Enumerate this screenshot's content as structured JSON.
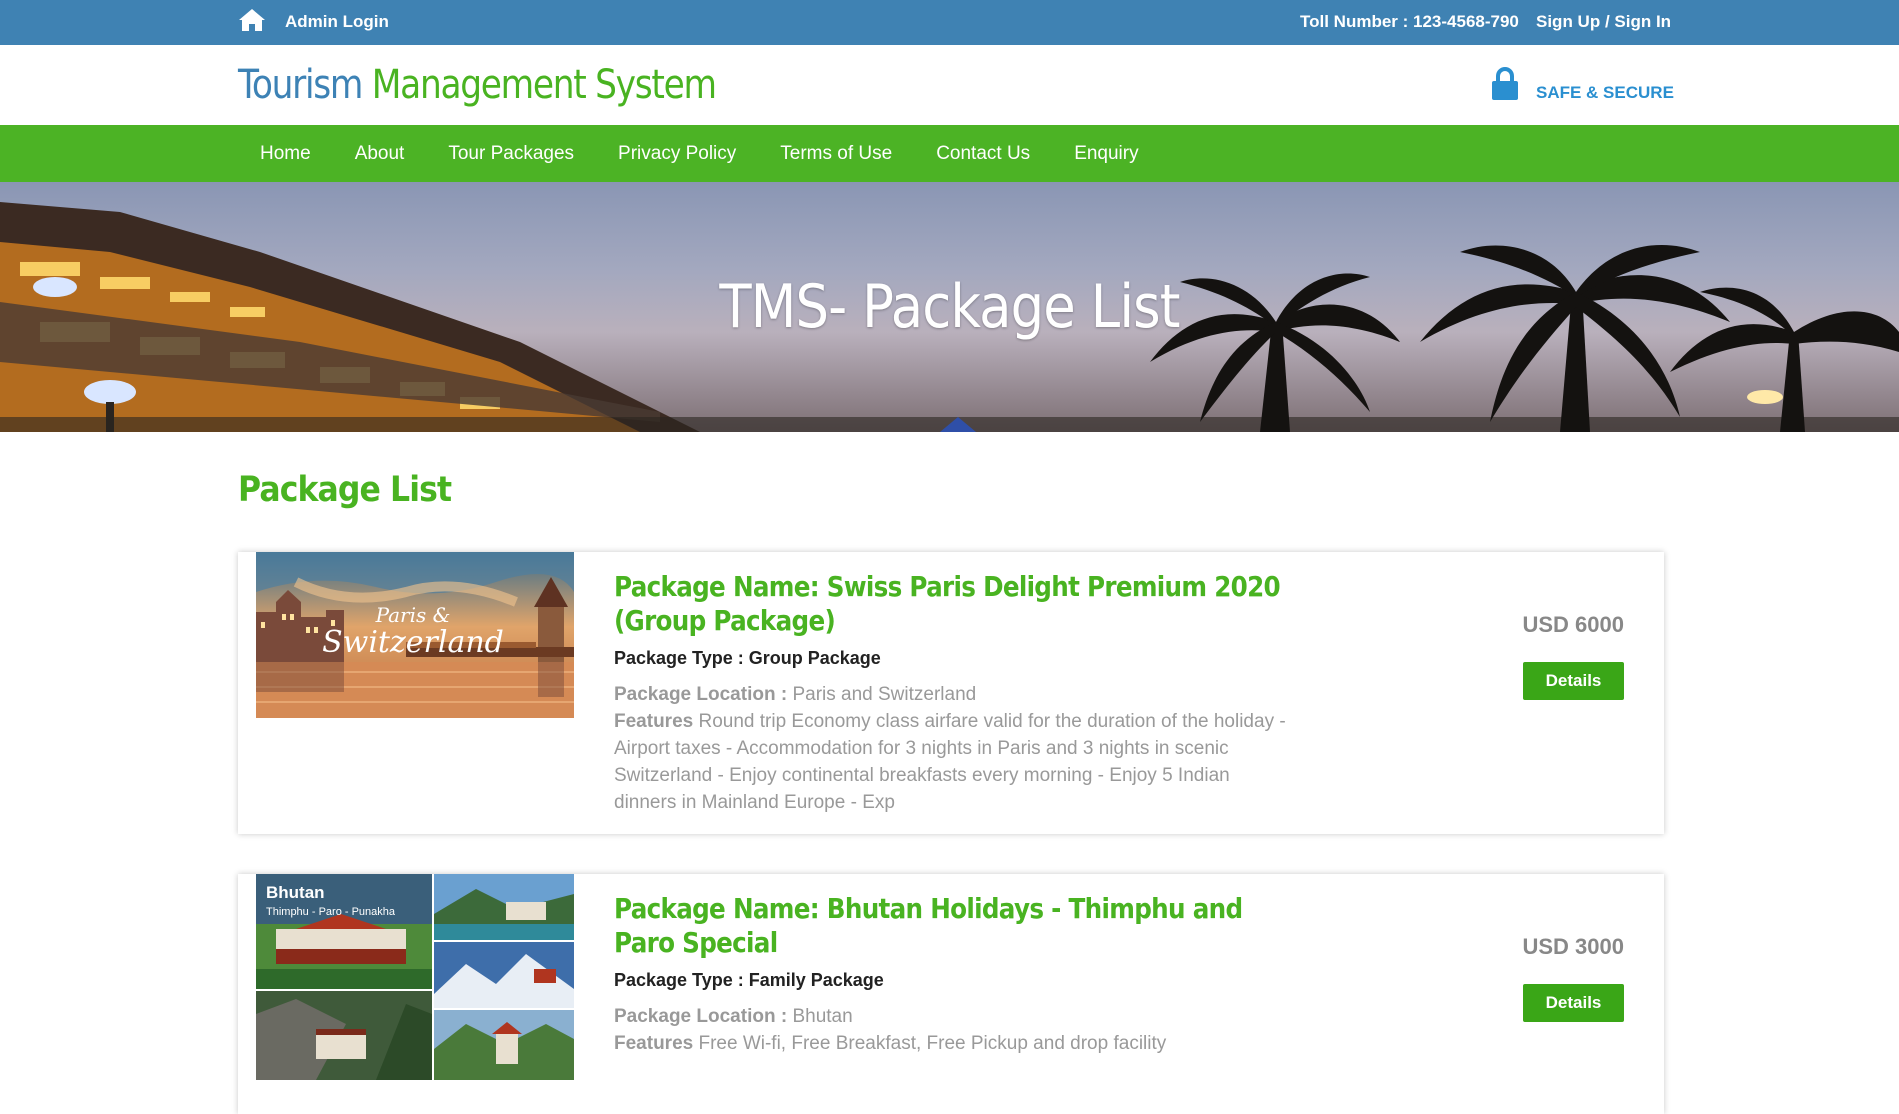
{
  "topbar": {
    "admin_login": "Admin Login",
    "toll_number": "Toll Number : 123-4568-790",
    "signup_signin": "Sign Up / Sign In"
  },
  "header": {
    "brand_word1": "Tourism",
    "brand_word2": "Management System",
    "secure_label": "SAFE & SECURE"
  },
  "nav": {
    "items": [
      "Home",
      "About",
      "Tour Packages",
      "Privacy Policy",
      "Terms of Use",
      "Contact Us",
      "Enquiry"
    ]
  },
  "banner": {
    "title": "TMS- Package List"
  },
  "main": {
    "section_title": "Package List",
    "packages": [
      {
        "name": "Package Name: Swiss Paris Delight Premium 2020 (Group Package)",
        "type": "Package Type : Group Package",
        "location_label": "Package Location :",
        "location": "Paris and Switzerland",
        "features_label": "Features",
        "features": "Round trip Economy class airfare valid for the duration of the holiday - Airport taxes - Accommodation for 3 nights in Paris and 3 nights in scenic Switzerland - Enjoy continental breakfasts every morning - Enjoy 5 Indian dinners in Mainland Europe - Exp",
        "price": "USD 6000",
        "details_label": "Details",
        "image_caption_line1": "Paris &",
        "image_caption_line2": "Switzerland"
      },
      {
        "name": "Package Name: Bhutan Holidays - Thimphu and Paro Special",
        "type": "Package Type : Family Package",
        "location_label": "Package Location :",
        "location": "Bhutan",
        "features_label": "Features",
        "features": "Free Wi-fi, Free Breakfast, Free Pickup and drop facility",
        "price": "USD 3000",
        "details_label": "Details",
        "image_caption_line1": "Bhutan",
        "image_caption_line2": "Thimphu - Paro - Punakha"
      }
    ]
  },
  "colors": {
    "topbar": "#3f82b3",
    "brand_blue": "#3d82b5",
    "brand_green": "#49b321",
    "nav_green": "#4cb325",
    "button_green": "#3aa617"
  },
  "icons": {
    "home": "home-icon",
    "lock": "lock-icon"
  }
}
